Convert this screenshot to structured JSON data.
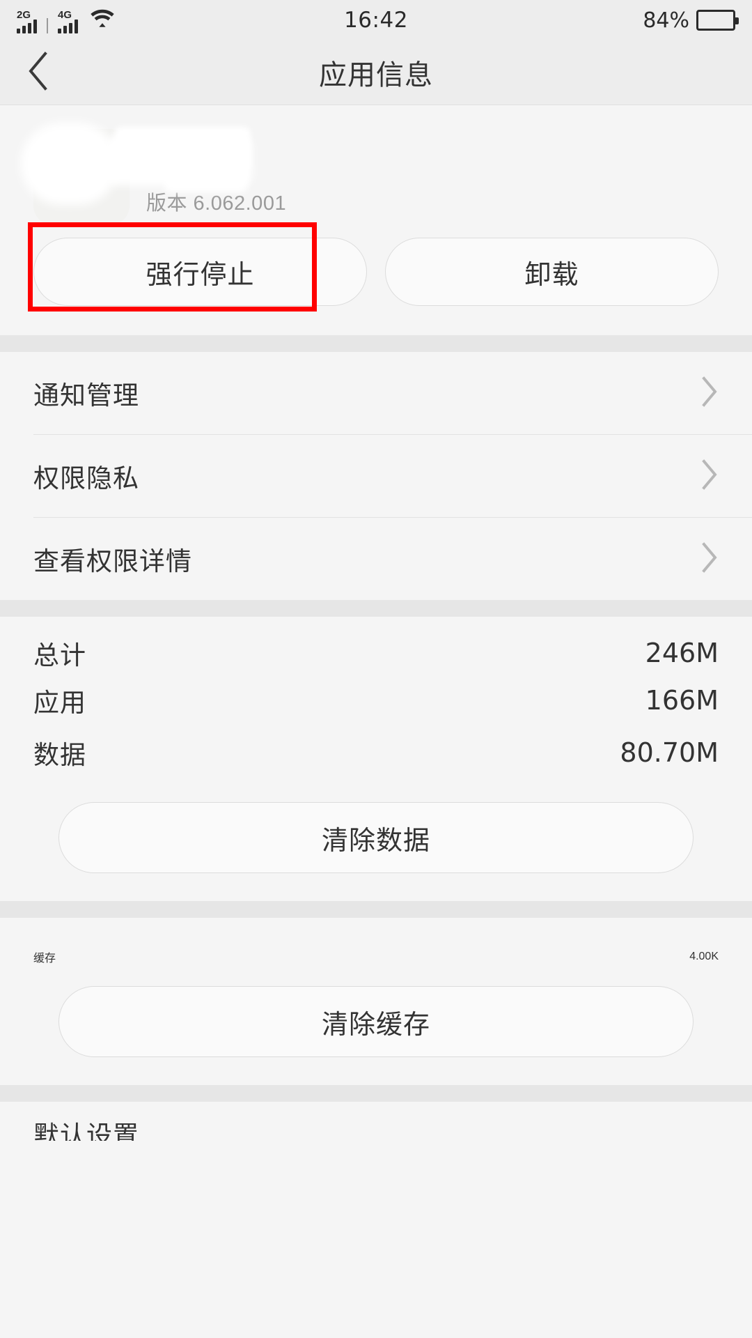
{
  "status_bar": {
    "network_1": "2G",
    "network_2": "4G",
    "wifi_icon": "wifi-icon",
    "time": "16:42",
    "battery_percent": "84%",
    "battery_level": 84
  },
  "header": {
    "back_icon": "back-chevron-icon",
    "title": "应用信息"
  },
  "app_info": {
    "app_icon": "app-icon-redacted",
    "app_name": "",
    "version_label": "版本 6.062.001"
  },
  "actions": {
    "force_stop_label": "强行停止",
    "uninstall_label": "卸载",
    "highlight_color": "#ff0000",
    "highlight_target": "force-stop-button"
  },
  "menu_rows": [
    {
      "label": "通知管理",
      "chevron": "chevron-right-icon"
    },
    {
      "label": "权限隐私",
      "chevron": "chevron-right-icon"
    },
    {
      "label": "查看权限详情",
      "chevron": "chevron-right-icon"
    }
  ],
  "storage": {
    "rows": [
      {
        "label": "总计",
        "value": "246M"
      },
      {
        "label": "应用",
        "value": "166M"
      },
      {
        "label": "数据",
        "value": "80.70M"
      }
    ],
    "clear_data_label": "清除数据"
  },
  "cache": {
    "label": "缓存",
    "value": "4.00K",
    "clear_cache_label": "清除缓存"
  },
  "bottom_row": {
    "label": "默认设置"
  },
  "colors": {
    "page_bg": "#f5f5f5",
    "bar_bg": "#ededed",
    "divider": "#e6e6e6",
    "text_primary": "#333333",
    "text_muted": "#9a9a9a",
    "accent_red": "#ff0000"
  }
}
